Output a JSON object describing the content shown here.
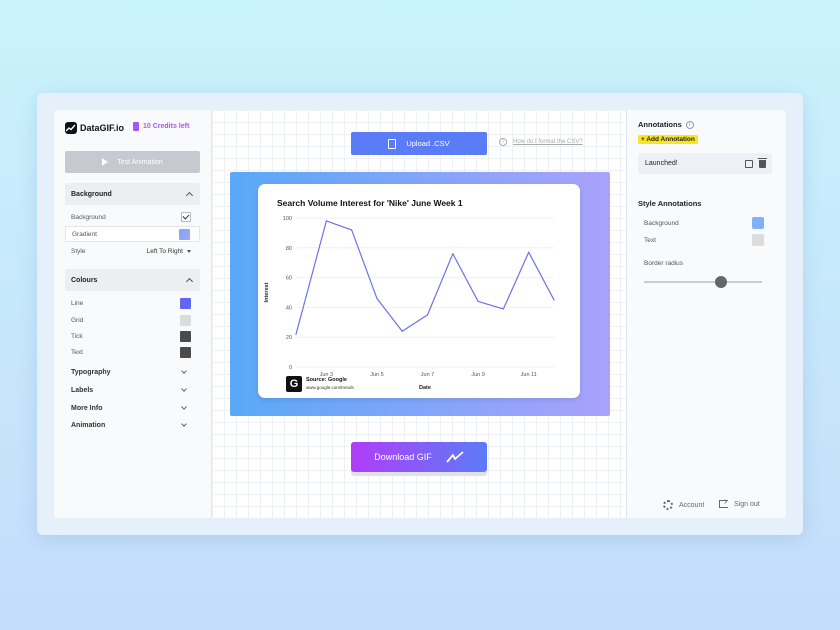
{
  "brand": {
    "name": "DataGIF.io",
    "credits": "10 Credits left"
  },
  "left": {
    "test_button": "Test Animation",
    "background_section": {
      "title": "Background",
      "rows": {
        "background": "Background",
        "gradient": "Gradient",
        "style": "Style",
        "style_value": "Left To Right"
      }
    },
    "colours_section": {
      "title": "Colours",
      "rows": [
        {
          "label": "Line",
          "color": "#6366f1"
        },
        {
          "label": "Grid",
          "color": "#dcdcdc"
        },
        {
          "label": "Tick",
          "color": "#4b4b4b"
        },
        {
          "label": "Text",
          "color": "#4b4b4b"
        }
      ]
    },
    "collapsed": [
      "Typography",
      "Labels",
      "More Info",
      "Animation"
    ]
  },
  "center": {
    "upload_button": "Upload .CSV",
    "help_link": "How do I format the CSV?",
    "download_button": "Download GIF",
    "source_title": "Source: Google",
    "source_url": "www.google.com/trends"
  },
  "chart_data": {
    "type": "line",
    "title": "Search Volume Interest for 'Nike' June Week 1",
    "xlabel": "Date",
    "ylabel": "Interest",
    "ylim": [
      0,
      100
    ],
    "yticks": [
      "0",
      "20",
      "40",
      "60",
      "80",
      "100"
    ],
    "xticks": [
      "Jun 3",
      "Jun 5",
      "Jun 7",
      "Jun 9",
      "Jun 11"
    ],
    "xtick_positions": [
      3,
      5,
      7,
      9,
      11
    ],
    "x": [
      1.8,
      3,
      4,
      5,
      6,
      7,
      8,
      9,
      10,
      11,
      12
    ],
    "values": [
      22,
      98,
      92,
      46,
      24,
      35,
      76,
      44,
      39,
      77,
      45
    ],
    "xlim": [
      1.8,
      12
    ],
    "line_color": "#6b72e8",
    "grid": true
  },
  "right": {
    "annotations_title": "Annotations",
    "add_annotation": "+ Add Annotation",
    "annotation_item": "Launched!",
    "style_title": "Style Annotations",
    "background_label": "Background",
    "background_color": "#7fb2f9",
    "text_label": "Text",
    "text_color": "#dcdcdc",
    "border_radius_label": "Border radius",
    "border_radius_value": 0.65,
    "account": "Account",
    "sign_out": "Sign out"
  },
  "colors": {
    "accent": "#5b7cf7",
    "credits": "#a855f7",
    "highlight": "#f7e51e"
  }
}
